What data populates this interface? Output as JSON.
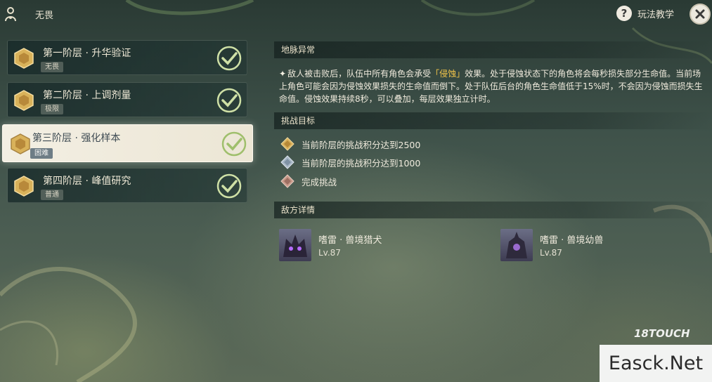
{
  "header": {
    "breadcrumb": "无畏",
    "help_label": "玩法教学"
  },
  "stages": [
    {
      "title": "第一阶层 · 升华验证",
      "difficulty": "无畏",
      "selected": false,
      "completed": true
    },
    {
      "title": "第二阶层 · 上调剂量",
      "difficulty": "极限",
      "selected": false,
      "completed": true
    },
    {
      "title": "第三阶层 · 强化样本",
      "difficulty": "困难",
      "selected": true,
      "completed": true
    },
    {
      "title": "第四阶层 · 峰值研究",
      "difficulty": "普通",
      "selected": false,
      "completed": true
    }
  ],
  "ley_line": {
    "heading": "地脉异常",
    "star": "✦",
    "text_before": "敌人被击败后，队伍中所有角色会承受",
    "highlight": "「侵蚀」",
    "text_after": "效果。处于侵蚀状态下的角色将会每秒损失部分生命值。当前场上角色可能会因为侵蚀效果损失的生命值而倒下。处于队伍后台的角色生命值低于15%时，不会因为侵蚀而损失生命值。侵蚀效果持续8秒，可以叠加，每层效果独立计时。"
  },
  "challenge": {
    "heading": "挑战目标",
    "goals": [
      {
        "icon": "gold-gem-icon",
        "text": "当前阶层的挑战积分达到2500"
      },
      {
        "icon": "silver-gem-icon",
        "text": "当前阶层的挑战积分达到1000"
      },
      {
        "icon": "bronze-gem-icon",
        "text": "完成挑战"
      }
    ]
  },
  "enemies": {
    "heading": "敌方详情",
    "list": [
      {
        "name": "嗜雷 · 兽境猎犬",
        "level": "Lv.87"
      },
      {
        "name": "嗜雷 · 兽境幼兽",
        "level": "Lv.87"
      }
    ]
  },
  "watermark": {
    "logo": "18TOUCH",
    "site": "Easck.Net"
  },
  "colors": {
    "highlight": "#f2c54a",
    "check": "#cfe0a6",
    "selected_bg": "#f3efe3"
  }
}
